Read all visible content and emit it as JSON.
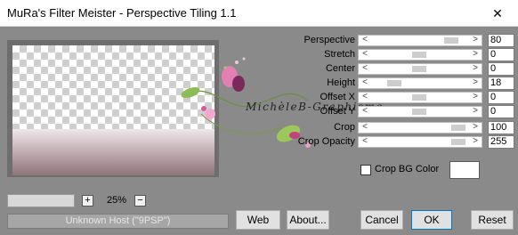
{
  "window": {
    "title": "MuRa's Filter Meister - Perspective Tiling 1.1",
    "close_glyph": "✕"
  },
  "preview": {
    "watermark": "MichèleB-Graphisme"
  },
  "params": [
    {
      "label": "Perspective",
      "value": "80",
      "level": 0.74
    },
    {
      "label": "Stretch",
      "value": "0",
      "level": 0.46
    },
    {
      "label": "Center",
      "value": "0",
      "level": 0.46
    },
    {
      "label": "Height",
      "value": "18",
      "level": 0.18
    },
    {
      "label": "Offset X",
      "value": "0",
      "level": 0.46
    },
    {
      "label": "Offset Y",
      "value": "0",
      "level": 0.46
    },
    {
      "label": "Crop",
      "value": "100",
      "level": 0.92
    },
    {
      "label": "Crop Opacity",
      "value": "255",
      "level": 0.92
    }
  ],
  "slider_arrows": {
    "left": "<",
    "right": ">"
  },
  "crop_bg": {
    "label": "Crop BG Color",
    "checked": false,
    "color": "#ffffff"
  },
  "zoom": {
    "plus": "+",
    "minus": "−",
    "value": "25%"
  },
  "status": {
    "text": "Unknown Host (\"9PSP\")"
  },
  "buttons": {
    "web": "Web",
    "about": "About...",
    "cancel": "Cancel",
    "ok": "OK",
    "reset": "Reset"
  }
}
